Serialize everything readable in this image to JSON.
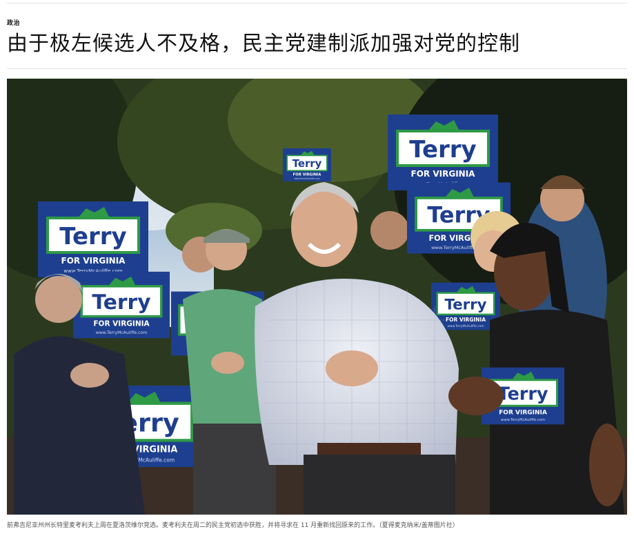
{
  "article": {
    "section": "政治",
    "headline": "由于极左候选人不及格，民主党建制派加强对党的控制",
    "caption": "前弗吉尼亚州州长特里麦考利夫上周在夏洛茨维尔竞选。麦考利夫在周二的民主党初选中获胜，并将寻求在 11 月重新找回原来的工作。（夏得麦克纳米/盖蒂图片社）"
  },
  "photo": {
    "alt": "Terry McAuliffe smiling and clapping among supporters holding campaign signs",
    "sign_name": "Terry",
    "sign_tagline": "FOR VIRGINIA",
    "sign_url": "www.TerryMcAuliffe.com",
    "colors": {
      "sign_blue": "#1e3f8f",
      "sign_green": "#2e9a46",
      "sky": "#a9c3dd",
      "foliage": "#2b3a1f"
    }
  }
}
